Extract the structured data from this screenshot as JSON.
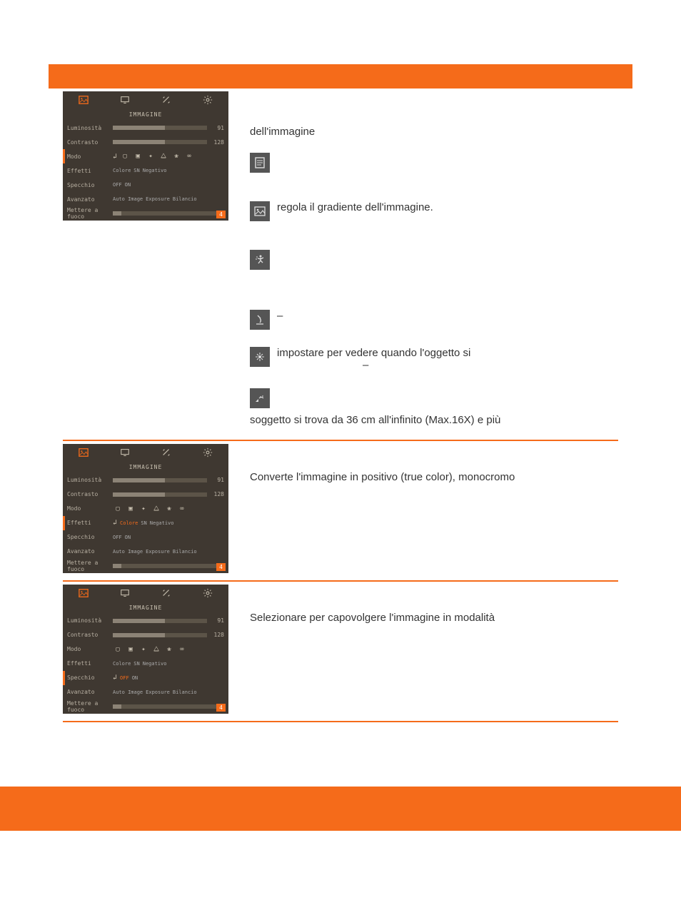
{
  "panel": {
    "title": "IMMAGINE",
    "tab_icons": [
      "image-icon",
      "display-icon",
      "tools-icon",
      "gear-icon"
    ],
    "rows": {
      "luminosita": {
        "label": "Luminosità",
        "value": "91"
      },
      "contrasto": {
        "label": "Contrasto",
        "value": "128"
      },
      "modo": {
        "label": "Modo"
      },
      "effetti": {
        "label": "Effetti",
        "opts": [
          "Colore",
          "SN",
          "Negativo"
        ]
      },
      "specchio": {
        "label": "Specchio",
        "opts": [
          "OFF",
          "ON"
        ]
      },
      "avanzato": {
        "label": "Avanzato",
        "opts": [
          "Auto Image",
          "Exposure",
          "Bilancio"
        ]
      },
      "focus": {
        "label": "Mettere a fuoco",
        "value": "4"
      }
    }
  },
  "section1": {
    "line1": "dell'immagine",
    "desc_grad": "regola il gradiente dell'immagine.",
    "desc_dash": "–",
    "desc_macro": "impostare per vedere quando l'oggetto si",
    "desc_macro2": "–",
    "desc_norm": "soggetto si trova da 36 cm all'infinito (Max.16X) e più"
  },
  "section2": {
    "text": "Converte l'immagine in positivo (true color), monocromo"
  },
  "section3": {
    "text": "Selezionare per capovolgere l'immagine in modalità"
  }
}
